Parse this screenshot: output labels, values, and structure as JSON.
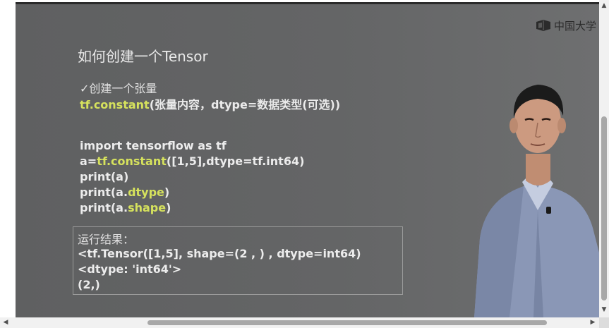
{
  "logo": {
    "text": "中国大学",
    "icon": "mooc-logo-icon"
  },
  "slide": {
    "title": "如何创建一个Tensor",
    "bullet": "✓创建一个张量",
    "syntax": {
      "fn": "tf.constant",
      "args": "(张量内容，dtype=数据类型(可选))"
    },
    "code": {
      "line1": "import tensorflow as tf",
      "line2_pre": "a=",
      "line2_fn": "tf.constant",
      "line2_post": "([1,5],dtype=tf.int64)",
      "line3": "print(a)",
      "line4_pre": "print(a.",
      "line4_attr": "dtype",
      "line4_post": ")",
      "line5_pre": "print(a.",
      "line5_attr": "shape",
      "line5_post": ")"
    },
    "result": {
      "label": "运行结果：",
      "line1": "<tf.Tensor([1,5], shape=(2 , ) , dtype=int64)",
      "line2": "<dtype: 'int64'>",
      "line3": "(2,)"
    },
    "highlight_color": "#d6e25d"
  },
  "scrollbars": {
    "up_arrow": "▲",
    "down_arrow": "▼",
    "left_arrow": "◀",
    "right_arrow": "▶"
  }
}
